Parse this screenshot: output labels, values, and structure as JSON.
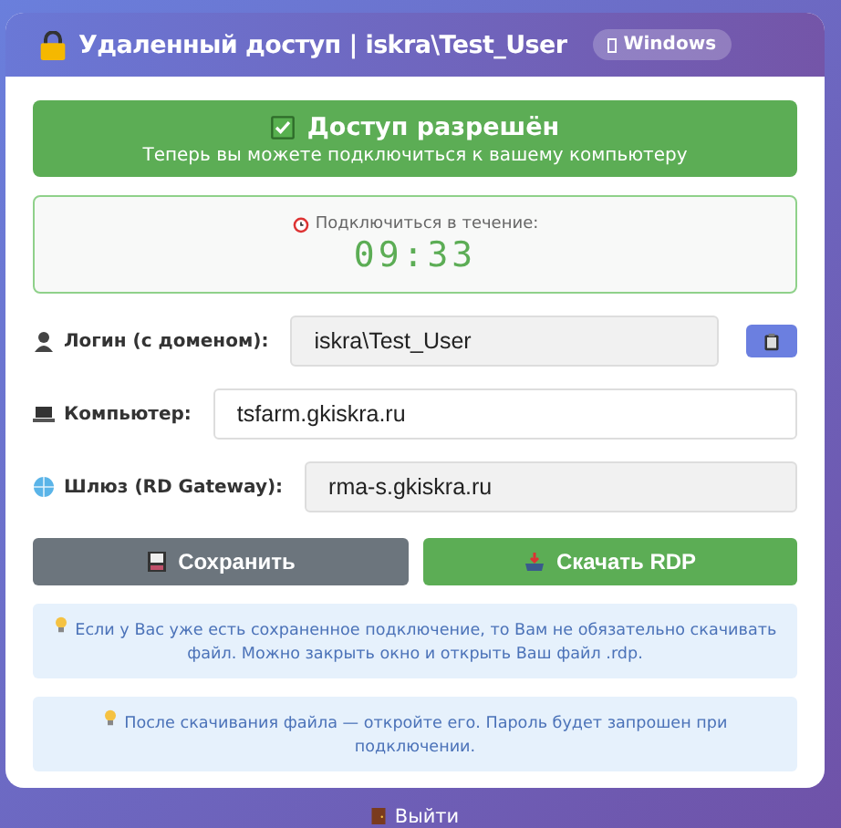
{
  "header": {
    "title": "Удаленный доступ | iskra\\Test_User",
    "badge": "Windows"
  },
  "status": {
    "title": "Доступ разрешён",
    "subtitle": "Теперь вы можете подключиться к вашему компьютеру"
  },
  "timer": {
    "label": "Подключиться в течение:",
    "value": "09:33"
  },
  "fields": [
    {
      "kind": "user",
      "label": "Логин (с доменом):",
      "value": "iskra\\Test_User",
      "readonly": true,
      "copy": true
    },
    {
      "kind": "computer",
      "label": "Компьютер:",
      "value": "tsfarm.gkiskra.ru",
      "readonly": false,
      "copy": false
    },
    {
      "kind": "globe",
      "label": "Шлюз (RD Gateway):",
      "value": "rma-s.gkiskra.ru",
      "readonly": true,
      "copy": false
    }
  ],
  "buttons": [
    {
      "kind": "save",
      "label": "Сохранить"
    },
    {
      "kind": "download",
      "label": "Скачать RDP"
    }
  ],
  "notes": [
    "Если у Вас уже есть сохраненное подключение, то Вам не обязательно скачивать файл. Можно закрыть окно и открыть Ваш файл .rdp.",
    "После скачивания файла — откройте его. Пароль будет запрошен при подключении."
  ],
  "logout": "Выйти"
}
